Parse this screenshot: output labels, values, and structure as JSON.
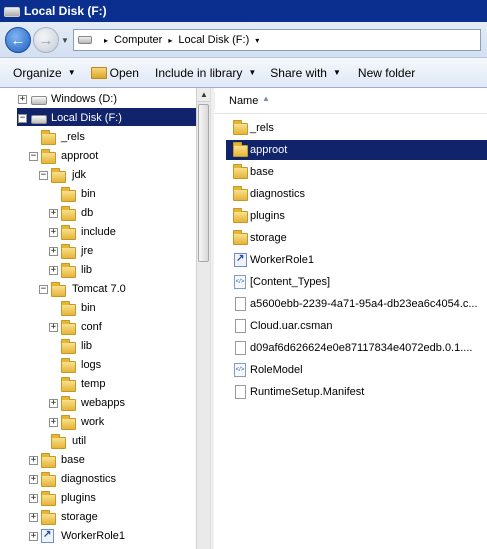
{
  "window": {
    "title": "Local Disk (F:)"
  },
  "address": {
    "crumbs": [
      "Computer",
      "Local Disk (F:)"
    ]
  },
  "toolbar": {
    "organize": "Organize",
    "open": "Open",
    "include": "Include in library",
    "share": "Share with",
    "new_folder": "New folder"
  },
  "tree": [
    {
      "label": "Windows (D:)",
      "icon": "drive-icon",
      "expander": "+",
      "indent": 0
    },
    {
      "label": "Local Disk (F:)",
      "icon": "drive-icon",
      "expander": "−",
      "indent": 0,
      "selected": true
    },
    {
      "label": "_rels",
      "icon": "folder-icon",
      "expander": "",
      "indent": 1
    },
    {
      "label": "approot",
      "icon": "folder-icon",
      "expander": "−",
      "indent": 1
    },
    {
      "label": "jdk",
      "icon": "folder-icon",
      "expander": "−",
      "indent": 2
    },
    {
      "label": "bin",
      "icon": "folder-icon",
      "expander": "",
      "indent": 3
    },
    {
      "label": "db",
      "icon": "folder-icon",
      "expander": "+",
      "indent": 3
    },
    {
      "label": "include",
      "icon": "folder-icon",
      "expander": "+",
      "indent": 3
    },
    {
      "label": "jre",
      "icon": "folder-icon",
      "expander": "+",
      "indent": 3
    },
    {
      "label": "lib",
      "icon": "folder-icon",
      "expander": "+",
      "indent": 3
    },
    {
      "label": "Tomcat 7.0",
      "icon": "folder-icon",
      "expander": "−",
      "indent": 2
    },
    {
      "label": "bin",
      "icon": "folder-icon",
      "expander": "",
      "indent": 3
    },
    {
      "label": "conf",
      "icon": "folder-icon",
      "expander": "+",
      "indent": 3
    },
    {
      "label": "lib",
      "icon": "folder-icon",
      "expander": "",
      "indent": 3
    },
    {
      "label": "logs",
      "icon": "folder-icon",
      "expander": "",
      "indent": 3
    },
    {
      "label": "temp",
      "icon": "folder-icon",
      "expander": "",
      "indent": 3
    },
    {
      "label": "webapps",
      "icon": "folder-icon",
      "expander": "+",
      "indent": 3
    },
    {
      "label": "work",
      "icon": "folder-icon",
      "expander": "+",
      "indent": 3
    },
    {
      "label": "util",
      "icon": "folder-icon",
      "expander": "",
      "indent": 2
    },
    {
      "label": "base",
      "icon": "folder-icon",
      "expander": "+",
      "indent": 1
    },
    {
      "label": "diagnostics",
      "icon": "folder-icon",
      "expander": "+",
      "indent": 1
    },
    {
      "label": "plugins",
      "icon": "folder-icon",
      "expander": "+",
      "indent": 1
    },
    {
      "label": "storage",
      "icon": "folder-icon",
      "expander": "+",
      "indent": 1
    },
    {
      "label": "WorkerRole1",
      "icon": "shortcut-icon",
      "expander": "+",
      "indent": 1
    }
  ],
  "list": {
    "column_name": "Name",
    "items": [
      {
        "label": "_rels",
        "icon": "folder-icon"
      },
      {
        "label": "approot",
        "icon": "folder-icon",
        "selected": true
      },
      {
        "label": "base",
        "icon": "folder-icon"
      },
      {
        "label": "diagnostics",
        "icon": "folder-icon"
      },
      {
        "label": "plugins",
        "icon": "folder-icon"
      },
      {
        "label": "storage",
        "icon": "folder-icon"
      },
      {
        "label": "WorkerRole1",
        "icon": "shortcut-icon"
      },
      {
        "label": "[Content_Types]",
        "icon": "xml-file-icon"
      },
      {
        "label": "a5600ebb-2239-4a71-95a4-db23ea6c4054.c...",
        "icon": "file-icon"
      },
      {
        "label": "Cloud.uar.csman",
        "icon": "file-icon"
      },
      {
        "label": "d09af6d626624e0e87117834e4072edb.0.1....",
        "icon": "file-icon"
      },
      {
        "label": "RoleModel",
        "icon": "xml-file-icon"
      },
      {
        "label": "RuntimeSetup.Manifest",
        "icon": "file-icon"
      }
    ]
  },
  "colors": {
    "selection": "#10236b",
    "titlebar": "#0b2f8f"
  }
}
